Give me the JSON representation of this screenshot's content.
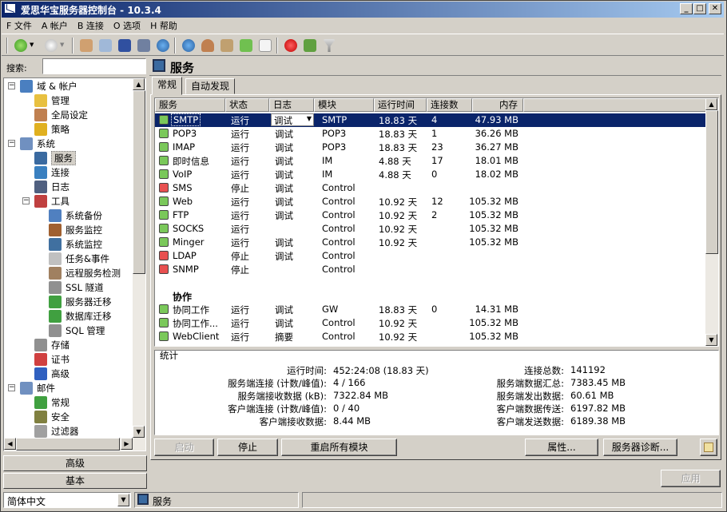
{
  "window": {
    "title": "爱思华宝服务器控制台 - 10.3.4"
  },
  "titlebar_buttons": {
    "minimize": "_",
    "maximize": "□",
    "close": "✕"
  },
  "menu": [
    "F 文件",
    "A 帐户",
    "B 连接",
    "O 选项",
    "H 帮助"
  ],
  "search": {
    "label": "搜索:",
    "value": ""
  },
  "tree": [
    {
      "label": "域 & 帐户",
      "level": 0,
      "exp": "−",
      "icon": "globe-icon",
      "color": "#4a7fc0"
    },
    {
      "label": "管理",
      "level": 1,
      "icon": "folder-icon",
      "color": "#e8c040"
    },
    {
      "label": "全局设定",
      "level": 1,
      "icon": "user-icon",
      "color": "#c08050"
    },
    {
      "label": "策略",
      "level": 1,
      "icon": "lock-icon",
      "color": "#e0b020"
    },
    {
      "label": "系统",
      "level": 0,
      "exp": "−",
      "icon": "system-icon",
      "color": "#7090c0"
    },
    {
      "label": "服务",
      "level": 1,
      "icon": "monitor-icon",
      "color": "#3a6aa0",
      "selected": true
    },
    {
      "label": "连接",
      "level": 1,
      "icon": "globe-icon",
      "color": "#3a80c0"
    },
    {
      "label": "日志",
      "level": 1,
      "icon": "log-icon",
      "color": "#506080"
    },
    {
      "label": "工具",
      "level": 1,
      "exp": "−",
      "icon": "tools-icon",
      "color": "#c04040"
    },
    {
      "label": "系统备份",
      "level": 2,
      "icon": "disk-icon",
      "color": "#5080c0"
    },
    {
      "label": "服务监控",
      "level": 2,
      "icon": "dog-icon",
      "color": "#a06030"
    },
    {
      "label": "系统监控",
      "level": 2,
      "icon": "monitor-icon",
      "color": "#4070a0"
    },
    {
      "label": "任务&事件",
      "level": 2,
      "icon": "clock-icon",
      "color": "#c0c0c0"
    },
    {
      "label": "远程服务检测",
      "level": 2,
      "icon": "gears-icon",
      "color": "#a08060"
    },
    {
      "label": "SSL 隧道",
      "level": 2,
      "icon": "tunnel-icon",
      "color": "#909090"
    },
    {
      "label": "服务器迁移",
      "level": 2,
      "icon": "migrate-icon",
      "color": "#40a040"
    },
    {
      "label": "数据库迁移",
      "level": 2,
      "icon": "db-migrate-icon",
      "color": "#40a040"
    },
    {
      "label": "SQL 管理",
      "level": 2,
      "icon": "sql-icon",
      "color": "#909090"
    },
    {
      "label": "存储",
      "level": 1,
      "icon": "storage-icon",
      "color": "#909090"
    },
    {
      "label": "证书",
      "level": 1,
      "icon": "certificate-icon",
      "color": "#d04040"
    },
    {
      "label": "高级",
      "level": 1,
      "icon": "advanced-icon",
      "color": "#3060c0"
    },
    {
      "label": "邮件",
      "level": 0,
      "exp": "−",
      "icon": "mail-icon",
      "color": "#7090c0"
    },
    {
      "label": "常规",
      "level": 1,
      "icon": "arrow-icon",
      "color": "#40a040"
    },
    {
      "label": "安全",
      "level": 1,
      "icon": "security-icon",
      "color": "#808040"
    },
    {
      "label": "过滤器",
      "level": 1,
      "icon": "filter-icon",
      "color": "#a0a0a0"
    }
  ],
  "nav": {
    "advanced": "高级",
    "basic": "基本"
  },
  "page": {
    "title": "服务",
    "tabs": [
      "常规",
      "自动发现"
    ]
  },
  "columns": [
    "服务",
    "状态",
    "日志",
    "模块",
    "运行时间",
    "连接数",
    "内存"
  ],
  "services": [
    {
      "name": "SMTP",
      "status": "运行",
      "log": "调试",
      "module": "SMTP",
      "uptime": "18.83 天",
      "conn": "4",
      "mem": "47.93 MB",
      "on": true,
      "selected": true
    },
    {
      "name": "POP3",
      "status": "运行",
      "log": "调试",
      "module": "POP3",
      "uptime": "18.83 天",
      "conn": "1",
      "mem": "36.26 MB",
      "on": true
    },
    {
      "name": "IMAP",
      "status": "运行",
      "log": "调试",
      "module": "POP3",
      "uptime": "18.83 天",
      "conn": "23",
      "mem": "36.27 MB",
      "on": true
    },
    {
      "name": "即时信息",
      "status": "运行",
      "log": "调试",
      "module": "IM",
      "uptime": "4.88 天",
      "conn": "17",
      "mem": "18.01 MB",
      "on": true
    },
    {
      "name": "VoIP",
      "status": "运行",
      "log": "调试",
      "module": "IM",
      "uptime": "4.88 天",
      "conn": "0",
      "mem": "18.02 MB",
      "on": true
    },
    {
      "name": "SMS",
      "status": "停止",
      "log": "调试",
      "module": "Control",
      "uptime": "",
      "conn": "",
      "mem": "",
      "on": false
    },
    {
      "name": "Web",
      "status": "运行",
      "log": "调试",
      "module": "Control",
      "uptime": "10.92 天",
      "conn": "12",
      "mem": "105.32 MB",
      "on": true
    },
    {
      "name": "FTP",
      "status": "运行",
      "log": "调试",
      "module": "Control",
      "uptime": "10.92 天",
      "conn": "2",
      "mem": "105.32 MB",
      "on": true
    },
    {
      "name": "SOCKS",
      "status": "运行",
      "log": "",
      "module": "Control",
      "uptime": "10.92 天",
      "conn": "",
      "mem": "105.32 MB",
      "on": true
    },
    {
      "name": "Minger",
      "status": "运行",
      "log": "调试",
      "module": "Control",
      "uptime": "10.92 天",
      "conn": "",
      "mem": "105.32 MB",
      "on": true
    },
    {
      "name": "LDAP",
      "status": "停止",
      "log": "调试",
      "module": "Control",
      "uptime": "",
      "conn": "",
      "mem": "",
      "on": false
    },
    {
      "name": "SNMP",
      "status": "停止",
      "log": "",
      "module": "Control",
      "uptime": "",
      "conn": "",
      "mem": "",
      "on": false
    }
  ],
  "collab_group": "协作",
  "collab": [
    {
      "name": "协同工作",
      "status": "运行",
      "log": "调试",
      "module": "GW",
      "uptime": "18.83 天",
      "conn": "0",
      "mem": "14.31 MB",
      "on": true
    },
    {
      "name": "协同工作...",
      "status": "运行",
      "log": "调试",
      "module": "Control",
      "uptime": "10.92 天",
      "conn": "",
      "mem": "105.32 MB",
      "on": true
    },
    {
      "name": "WebClient",
      "status": "运行",
      "log": "摘要",
      "module": "Control",
      "uptime": "10.92 天",
      "conn": "",
      "mem": "105.32 MB",
      "on": true
    }
  ],
  "stats": {
    "title": "统计",
    "left": [
      {
        "label": "运行时间:",
        "value": "452:24:08 (18.83 天)"
      },
      {
        "label": "服务端连接 (计数/峰值):",
        "value": "4 / 166"
      },
      {
        "label": "服务端接收数据 (kB):",
        "value": "7322.84 MB"
      },
      {
        "label": "客户端连接 (计数/峰值):",
        "value": "0 / 40"
      },
      {
        "label": "客户端接收数据:",
        "value": "8.44 MB"
      }
    ],
    "right": [
      {
        "label": "连接总数:",
        "value": "141192"
      },
      {
        "label": "服务端数据汇总:",
        "value": "7383.45 MB"
      },
      {
        "label": "服务端发出数据:",
        "value": "60.61 MB"
      },
      {
        "label": "客户端数据传送:",
        "value": "6197.82 MB"
      },
      {
        "label": "客户端发送数据:",
        "value": "6189.38 MB"
      }
    ]
  },
  "buttons": {
    "start": "启动",
    "stop": "停止",
    "restart": "重启所有模块",
    "props": "属性...",
    "diag": "服务器诊断...",
    "apply": "应用"
  },
  "status": {
    "language": "简体中文",
    "current": "服务"
  },
  "log_dropdown_arrow": "▼",
  "scroll_up": "▲",
  "scroll_down": "▼",
  "scroll_left": "◀",
  "scroll_right": "▶"
}
